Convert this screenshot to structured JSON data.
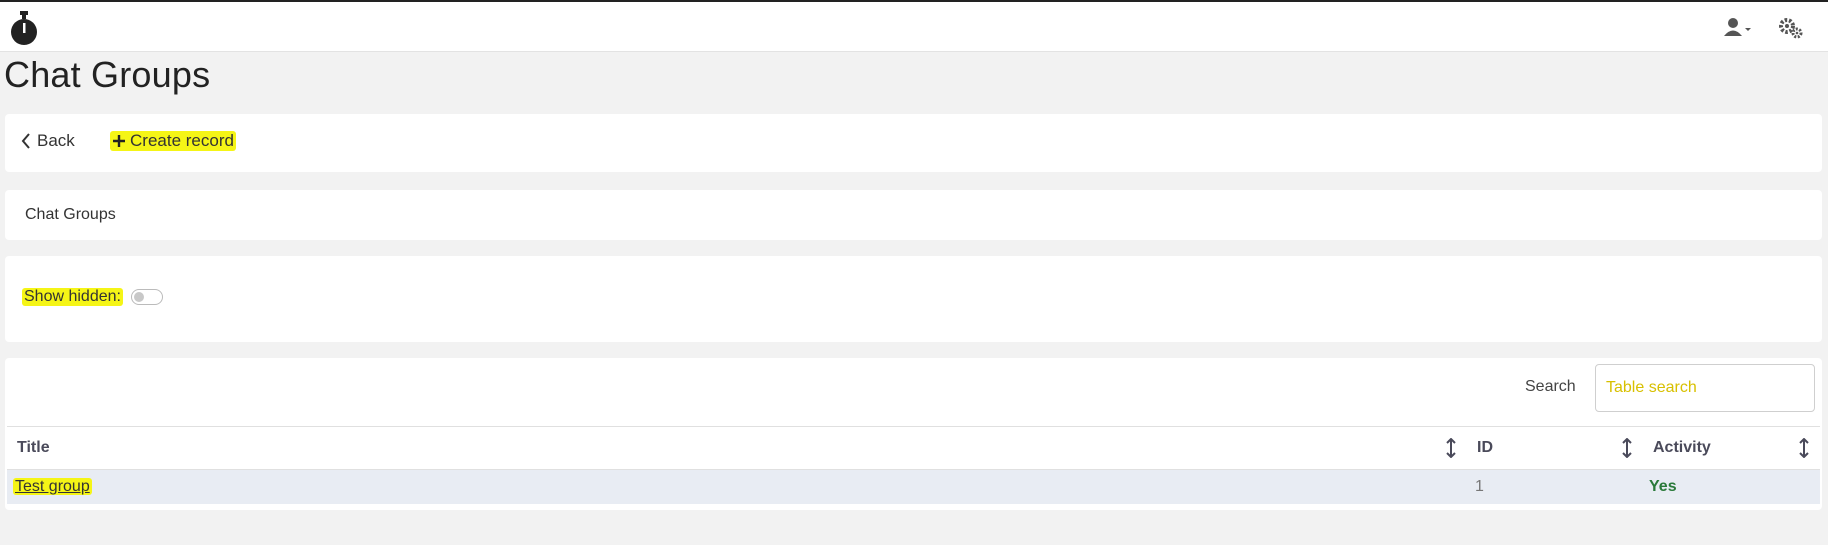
{
  "header": {
    "logo": "stopwatch-icon",
    "user_icon": "user-icon",
    "settings_icon": "gears-icon"
  },
  "page": {
    "title": "Chat Groups"
  },
  "toolbar": {
    "back_label": "Back",
    "create_label": "Create record"
  },
  "breadcrumb": {
    "label": "Chat Groups"
  },
  "filters": {
    "show_hidden_label": "Show hidden:"
  },
  "search": {
    "label": "Search",
    "placeholder": "Table search"
  },
  "table": {
    "columns": [
      "Title",
      "ID",
      "Activity"
    ],
    "rows": [
      {
        "title": "Test group",
        "id": "1",
        "activity": "Yes"
      }
    ]
  },
  "colors": {
    "highlight": "#f5f516",
    "activity_yes": "#2a7a3a",
    "row_bg": "#e8ecf3"
  }
}
